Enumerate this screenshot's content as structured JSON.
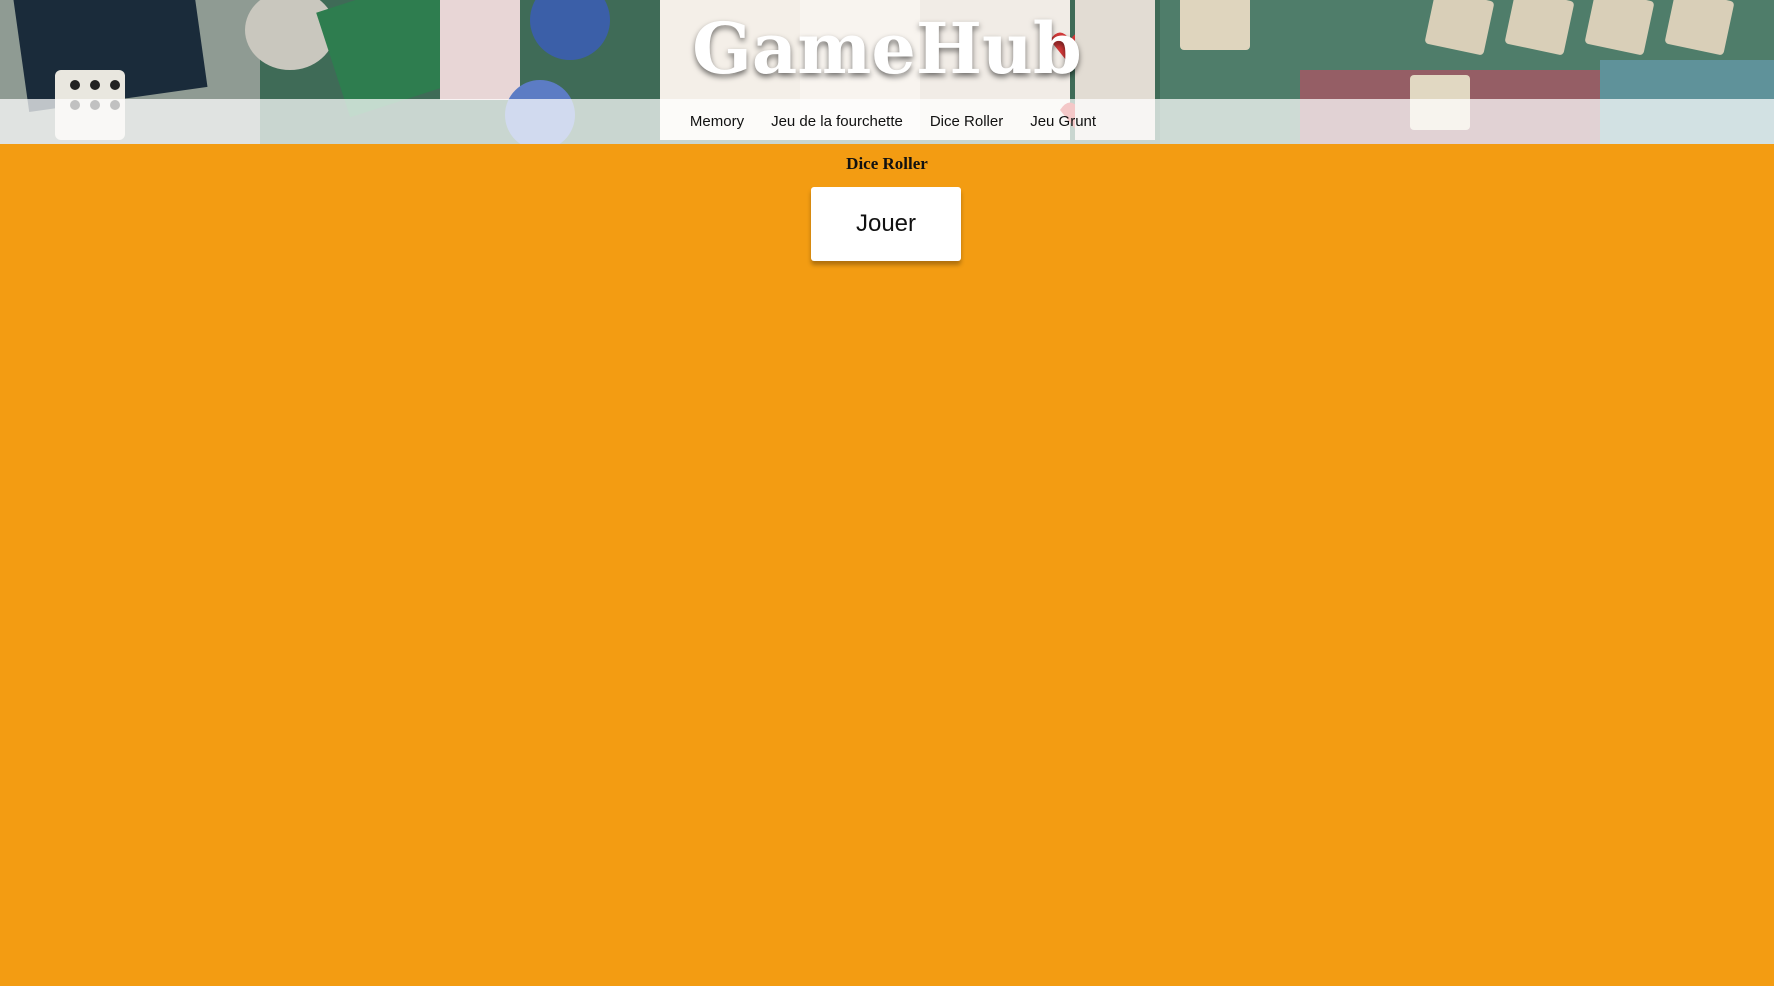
{
  "header": {
    "title": "GameHub",
    "background_image": "board-games-collage"
  },
  "nav": {
    "items": [
      {
        "label": "Memory"
      },
      {
        "label": "Jeu de la fourchette"
      },
      {
        "label": "Dice Roller"
      },
      {
        "label": "Jeu Grunt"
      }
    ]
  },
  "main": {
    "heading": "Dice Roller",
    "play_button_label": "Jouer"
  },
  "colors": {
    "page_background": "#f39c12",
    "nav_background": "rgba(255,255,255,0.72)",
    "button_background": "#ffffff"
  }
}
